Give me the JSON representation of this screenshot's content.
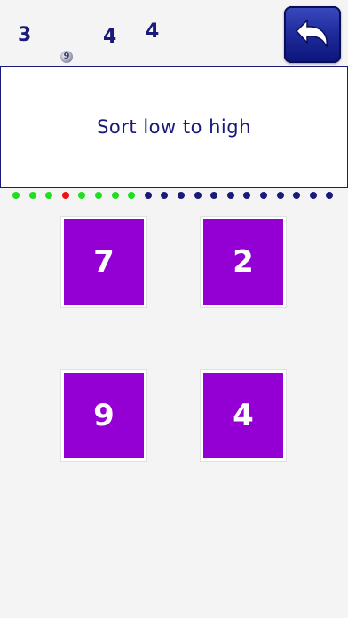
{
  "floating_numbers": [
    "3",
    "4",
    "4"
  ],
  "ghost_number": "9",
  "back_button": {
    "icon": "undo-arrow-icon"
  },
  "prompt": "Sort low to high",
  "progress": {
    "dots": [
      "green",
      "green",
      "green",
      "red",
      "green",
      "green",
      "green",
      "green",
      "navy",
      "navy",
      "navy",
      "navy",
      "navy",
      "navy",
      "navy",
      "navy",
      "navy",
      "navy",
      "navy",
      "navy"
    ],
    "colors": {
      "green": "#22dd22",
      "red": "#ee1111",
      "navy": "#1a1a7a"
    }
  },
  "tiles": [
    {
      "value": "7"
    },
    {
      "value": "2"
    },
    {
      "value": "9"
    },
    {
      "value": "4"
    }
  ],
  "tile_color": "#9400d3"
}
